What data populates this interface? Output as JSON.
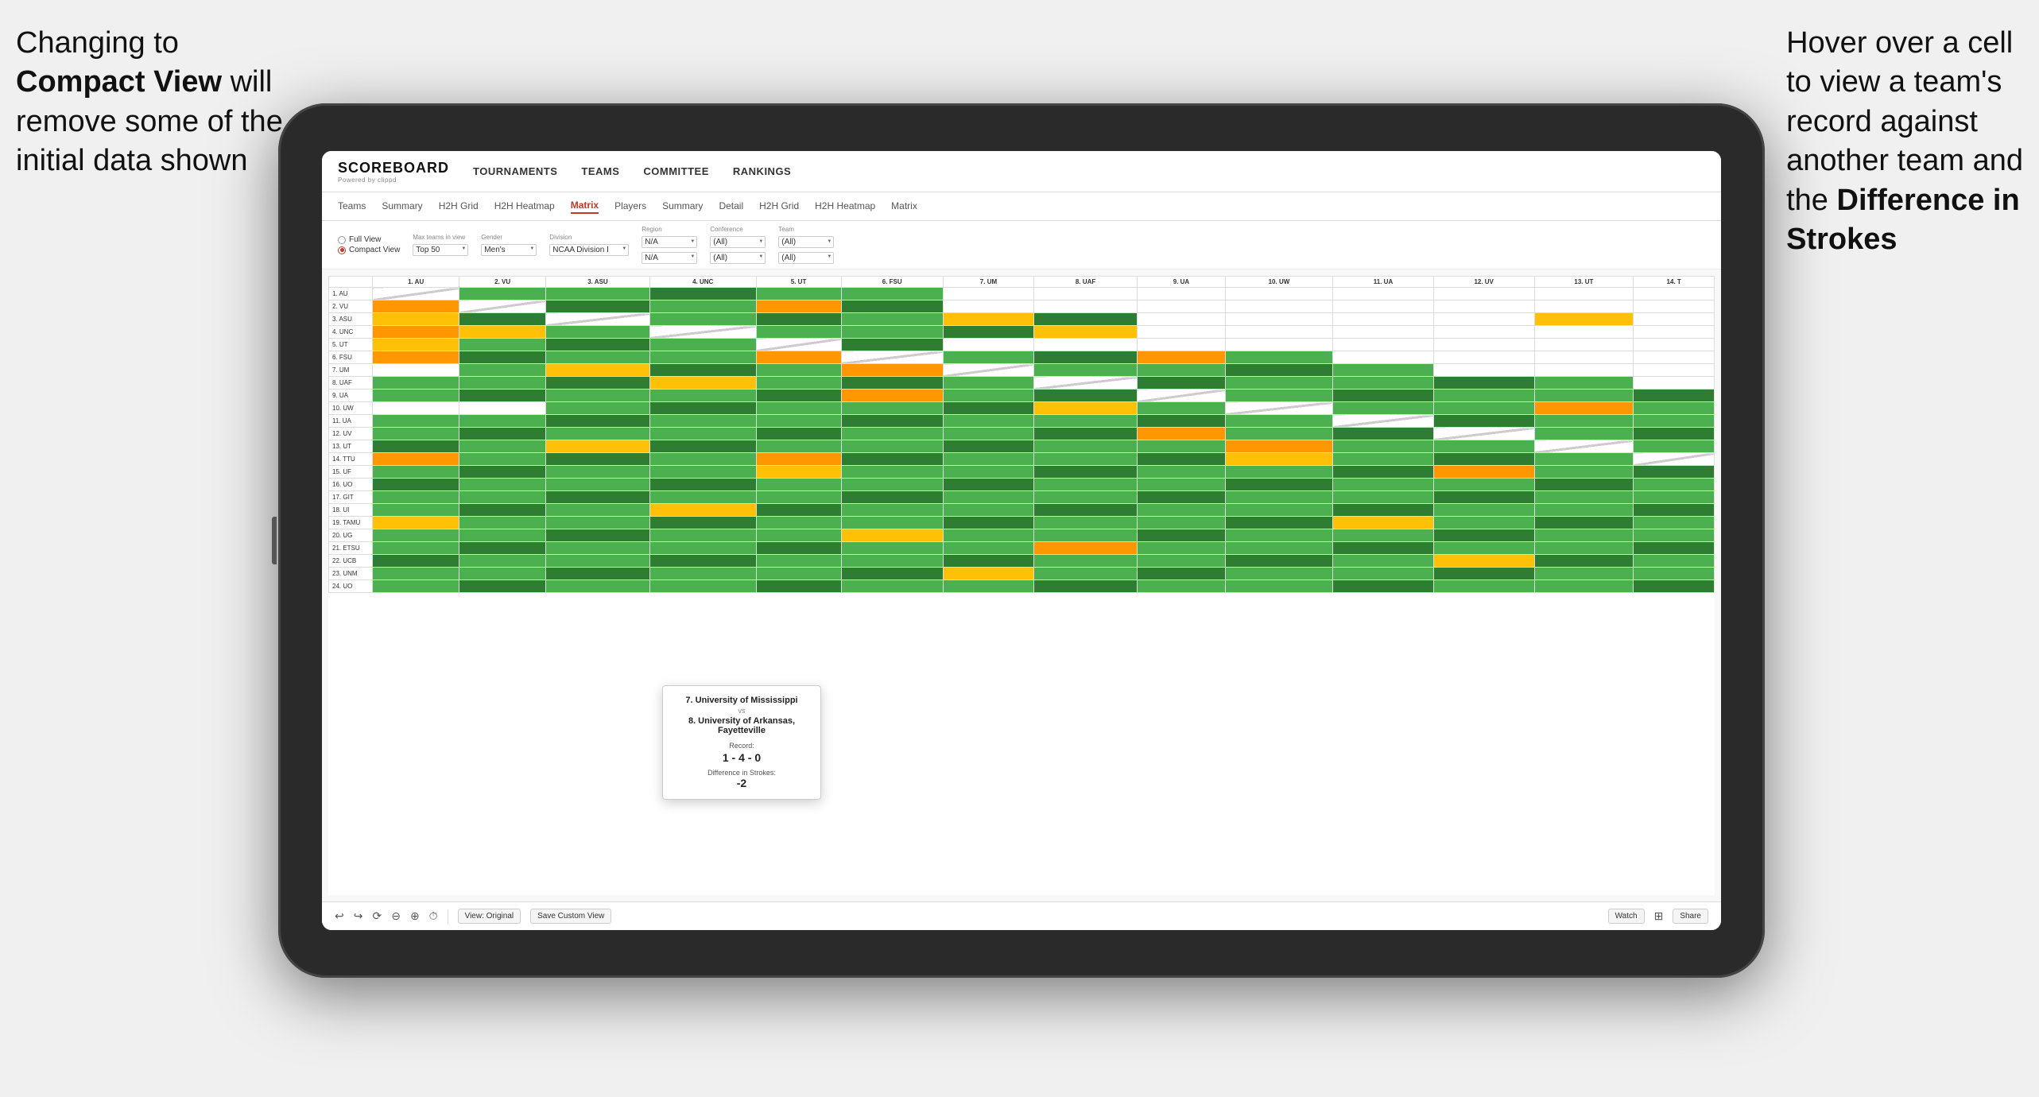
{
  "annotations": {
    "left": {
      "line1": "Changing to",
      "line2_bold": "Compact View",
      "line2_normal": " will",
      "line3": "remove some of the",
      "line4": "initial data shown"
    },
    "right": {
      "line1": "Hover over a cell",
      "line2": "to view a team's",
      "line3": "record against",
      "line4": "another team and",
      "line5_pre": "the ",
      "line5_bold": "Difference in",
      "line6_bold": "Strokes"
    }
  },
  "nav": {
    "logo": "SCOREBOARD",
    "logo_sub": "Powered by clippd",
    "items": [
      "TOURNAMENTS",
      "TEAMS",
      "COMMITTEE",
      "RANKINGS"
    ]
  },
  "sub_nav": {
    "items": [
      "Teams",
      "Summary",
      "H2H Grid",
      "H2H Heatmap",
      "Matrix",
      "Players",
      "Summary",
      "Detail",
      "H2H Grid",
      "H2H Heatmap",
      "Matrix"
    ],
    "active_index": 4
  },
  "filters": {
    "view_options": [
      "Full View",
      "Compact View"
    ],
    "selected_view": "Compact View",
    "max_teams_label": "Max teams in view",
    "max_teams_value": "Top 50",
    "gender_label": "Gender",
    "gender_value": "Men's",
    "division_label": "Division",
    "division_value": "NCAA Division I",
    "region_label": "Region",
    "region_rows": [
      "N/A",
      "N/A"
    ],
    "conference_label": "Conference",
    "conference_rows": [
      "(All)",
      "(All)"
    ],
    "team_label": "Team",
    "team_rows": [
      "(All)",
      "(All)"
    ]
  },
  "matrix": {
    "col_headers": [
      "1. AU",
      "2. VU",
      "3. ASU",
      "4. UNC",
      "5. UT",
      "6. FSU",
      "7. UM",
      "8. UAF",
      "9. UA",
      "10. UW",
      "11. UA",
      "12. UV",
      "13. UT",
      "14. T"
    ],
    "row_teams": [
      "1. AU",
      "2. VU",
      "3. ASU",
      "4. UNC",
      "5. UT",
      "6. FSU",
      "7. UM",
      "8. UAF",
      "9. UA",
      "10. UW",
      "11. UA",
      "12. UV",
      "13. UT",
      "14. TTU",
      "15. UF",
      "16. UO",
      "17. GIT",
      "18. UI",
      "19. TAMU",
      "20. UG",
      "21. ETSU",
      "22. UCB",
      "23. UNM",
      "24. UO"
    ]
  },
  "tooltip": {
    "team1": "7. University of Mississippi",
    "vs": "vs",
    "team2": "8. University of Arkansas, Fayetteville",
    "record_label": "Record:",
    "record_value": "1 - 4 - 0",
    "strokes_label": "Difference in Strokes:",
    "strokes_value": "-2"
  },
  "toolbar": {
    "view_original": "View: Original",
    "save_custom": "Save Custom View",
    "watch": "Watch",
    "share": "Share"
  }
}
